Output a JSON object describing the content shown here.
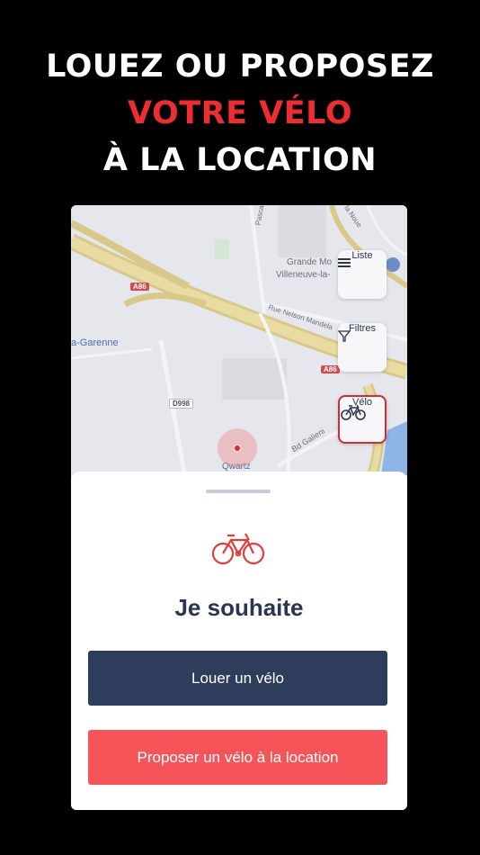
{
  "headline": {
    "line1": "LOUEZ OU PROPOSEZ",
    "line2": "VOTRE VÉLO",
    "line3": "À LA LOCATION"
  },
  "map": {
    "labels": {
      "grande": "Grande Mo",
      "villeneuve": "Villeneuve-la-",
      "garenne": "a-Garenne",
      "nelson": "Rue Nelson Mandela",
      "galieni": "Bd Galieni",
      "qwartz": "Qwartz",
      "pascal": "Pascal",
      "noue": "la Noue"
    },
    "road_tags": {
      "a86_left": "A86",
      "a86_right": "A86",
      "d998": "D998"
    },
    "buttons": {
      "list": {
        "label": "Liste",
        "icon": "menu-icon"
      },
      "filters": {
        "label": "Filtres",
        "icon": "filter-icon"
      },
      "bike": {
        "label": "Vélo",
        "icon": "bicycle-icon"
      }
    }
  },
  "sheet": {
    "title": "Je souhaite",
    "rent_label": "Louer un vélo",
    "offer_label": "Proposer un vélo à la location"
  },
  "colors": {
    "accent": "#ee2d33",
    "navy": "#2f3d5c",
    "coral": "#f55558"
  }
}
